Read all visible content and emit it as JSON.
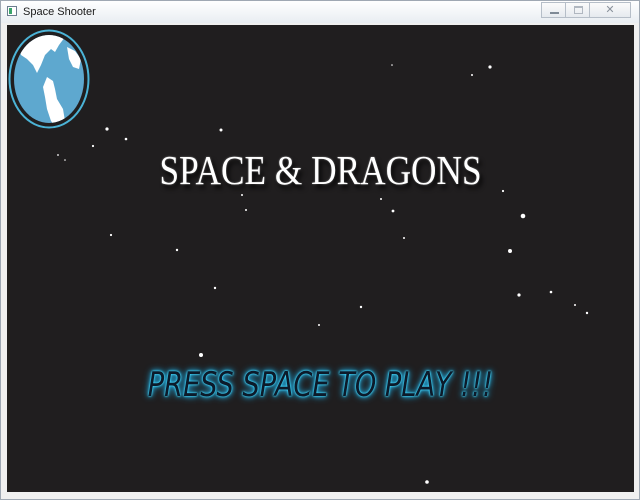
{
  "window": {
    "title": "Space Shooter",
    "controls": {
      "minimize_icon": "minimize-icon",
      "maximize_icon": "maximize-icon",
      "close_glyph": "✕"
    }
  },
  "game": {
    "title": "SPACE & DRAGONS",
    "prompt": "PRESS SPACE TO PLAY !!!",
    "planet_icon": "earth-globe-icon",
    "colors": {
      "background": "#201e1f",
      "title_text": "#ffffff",
      "prompt_glow": "#36c9f5",
      "planet_ocean": "#5ea8cf",
      "planet_land": "#ffffff",
      "planet_ring": "#4bb3d6"
    }
  }
}
